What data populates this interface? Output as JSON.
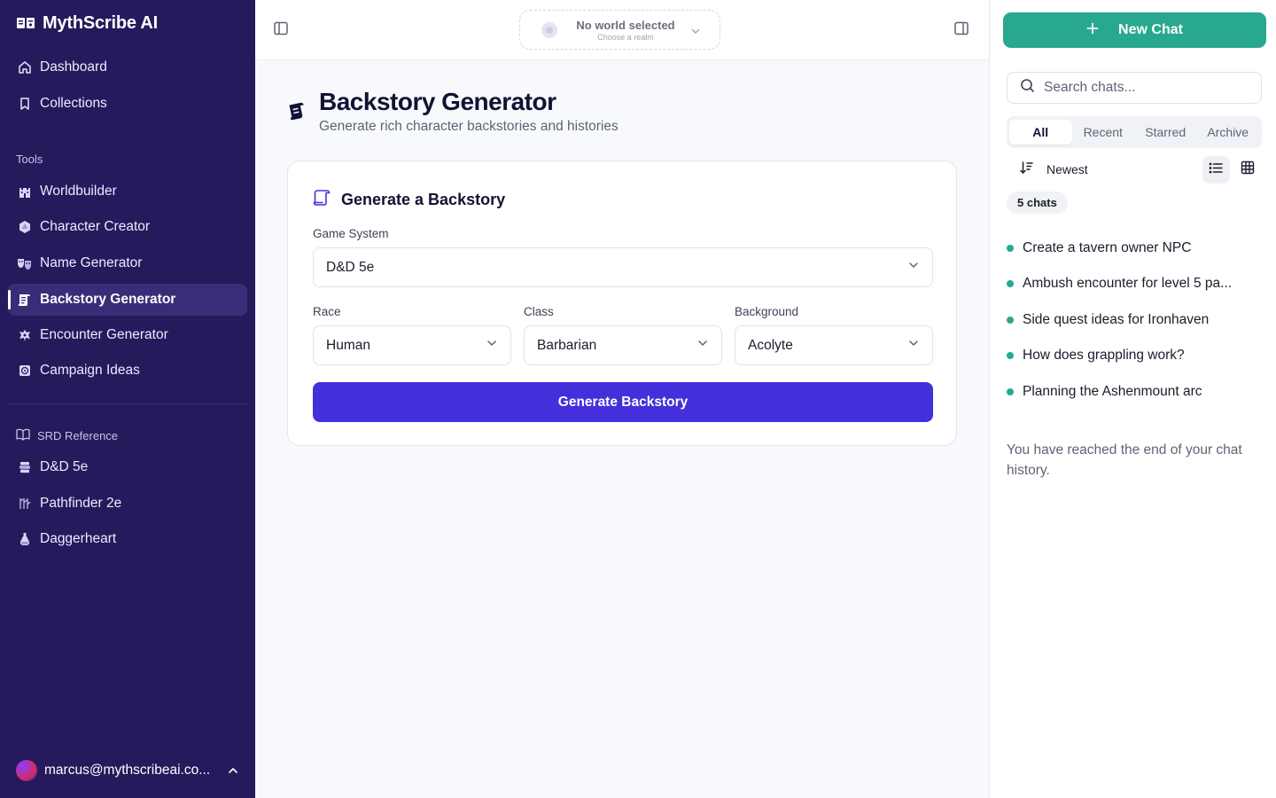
{
  "brand": {
    "name": "MythScribe AI"
  },
  "sidebar": {
    "main_items": [
      {
        "label": "Dashboard",
        "icon": "home-icon"
      },
      {
        "label": "Collections",
        "icon": "bookmark-icon"
      }
    ],
    "tools_label": "Tools",
    "tools": [
      {
        "label": "Worldbuilder",
        "icon": "castle-icon"
      },
      {
        "label": "Character Creator",
        "icon": "d20-icon"
      },
      {
        "label": "Name Generator",
        "icon": "masks-icon"
      },
      {
        "label": "Backstory Generator",
        "icon": "scroll-icon",
        "active": true
      },
      {
        "label": "Encounter Generator",
        "icon": "dragon-icon"
      },
      {
        "label": "Campaign Ideas",
        "icon": "map-icon"
      }
    ],
    "srd_label": "SRD Reference",
    "srd": [
      {
        "label": "D&D 5e",
        "icon": "book-stack-icon"
      },
      {
        "label": "Pathfinder 2e",
        "icon": "runes-icon"
      },
      {
        "label": "Daggerheart",
        "icon": "potion-icon"
      }
    ],
    "user_email": "marcus@mythscribeai.co..."
  },
  "topbar": {
    "world_title": "No world selected",
    "world_sub": "Choose a realm"
  },
  "page": {
    "title": "Backstory Generator",
    "subtitle": "Generate rich character backstories and histories"
  },
  "form": {
    "heading": "Generate a Backstory",
    "game_system_label": "Game System",
    "game_system_value": "D&D 5e",
    "race_label": "Race",
    "race_value": "Human",
    "class_label": "Class",
    "class_value": "Barbarian",
    "background_label": "Background",
    "background_value": "Acolyte",
    "submit_label": "Generate Backstory"
  },
  "chat_panel": {
    "new_chat_label": "New Chat",
    "search_placeholder": "Search chats...",
    "tabs": [
      "All",
      "Recent",
      "Starred",
      "Archive"
    ],
    "active_tab": "All",
    "sort_label": "Newest",
    "count_label": "5 chats",
    "chats": [
      "Create a tavern owner NPC",
      "Ambush encounter for level 5 pa...",
      "Side quest ideas for Ironhaven",
      "How does grappling work?",
      "Planning the Ashenmount arc"
    ],
    "end_note": "You have reached the end of your chat history."
  },
  "colors": {
    "sidebar_bg": "#261a5c",
    "primary": "#4330db",
    "accent": "#27a88f"
  }
}
